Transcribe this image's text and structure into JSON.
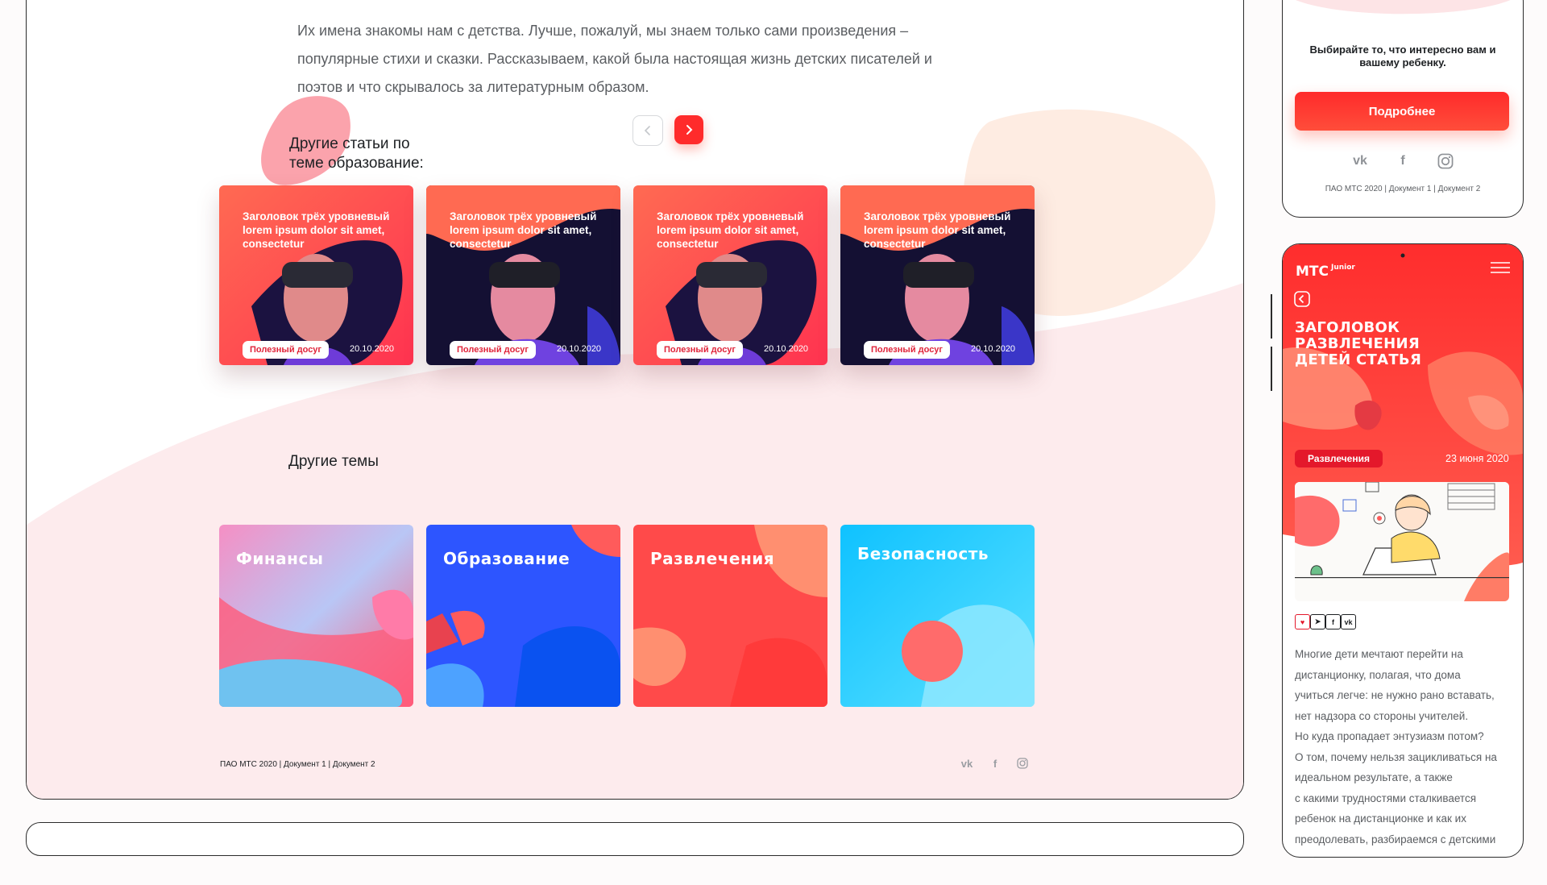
{
  "intro": {
    "lines": [
      "Их имена знакомы нам с детства. Лучше, пожалуй, мы знаем только сами произведения –",
      "популярные стихи и сказки. Рассказываем, какой была настоящая жизнь детских писателей и",
      "поэтов и что скрывалось за литературным образом."
    ]
  },
  "related": {
    "title_line1": "Другие статьи по",
    "title_line2": "теме образование:",
    "prev_icon": "chevron-left-icon",
    "next_icon": "chevron-right-icon",
    "cards": [
      {
        "title": "Заголовок трёх уровневый lorem ipsum dolor sit amet, consectetur",
        "tag": "Полезный досуг",
        "date": "20.10.2020"
      },
      {
        "title": "Заголовок трёх уровневый lorem ipsum dolor sit amet, consectetur",
        "tag": "Полезный досуг",
        "date": "20.10.2020"
      },
      {
        "title": "Заголовок трёх уровневый lorem ipsum dolor sit amet, consectetur",
        "tag": "Полезный досуг",
        "date": "20.10.2020"
      },
      {
        "title": "Заголовок трёх уровневый lorem ipsum dolor sit amet, consectetur",
        "tag": "Полезный досуг",
        "date": "20.10.2020"
      }
    ]
  },
  "topics": {
    "title": "Другие темы",
    "items": [
      {
        "label": "Финансы"
      },
      {
        "label": "Образование"
      },
      {
        "label": "Развлечения"
      },
      {
        "label": "Безопасность"
      }
    ]
  },
  "footer": {
    "text": "ПАО МТС 2020 | Документ 1 | Документ 2",
    "social": [
      "vk-icon",
      "facebook-icon",
      "instagram-icon"
    ],
    "vk": "vk",
    "fb": "f"
  },
  "phone_top": {
    "text": "Выбирайте то, что интересно вам и вашему ребенку.",
    "button": "Подробнее",
    "vk": "vk",
    "fb": "f",
    "footer": "ПАО МТС 2020 | Документ 1 | Документ 2"
  },
  "phone_article": {
    "logo": "МТС",
    "logo_sub": "Junior",
    "title": "ЗАГОЛОВОК РАЗВЛЕЧЕНИЯ ДЕТЕЙ СТАТЬЯ",
    "tag": "Развлечения",
    "date": "23 июня 2020",
    "share": [
      {
        "icon": "heart-icon",
        "glyph": "♥"
      },
      {
        "icon": "telegram-icon",
        "glyph": "➤"
      },
      {
        "icon": "facebook-icon",
        "glyph": "f"
      },
      {
        "icon": "vk-icon",
        "glyph": "vk"
      }
    ],
    "body": [
      "Многие дети мечтают перейти на",
      "дистанционку, полагая, что дома",
      "учиться легче: не нужно рано вставать,",
      "нет надзора со стороны учителей.",
      "Но куда пропадает энтузиазм потом?",
      "О том, почему нельзя зацикливаться на",
      "идеальном результате, а также",
      "с какими трудностями сталкивается",
      "ребенок на дистанционке и как их",
      "преодолевать, разбираемся с детскими"
    ]
  },
  "colors": {
    "brand_red": "#ff2b2b",
    "finance": "#f58fc4",
    "education": "#2d55ff",
    "entertainment": "#ff4d4d",
    "security": "#16c4ff"
  }
}
